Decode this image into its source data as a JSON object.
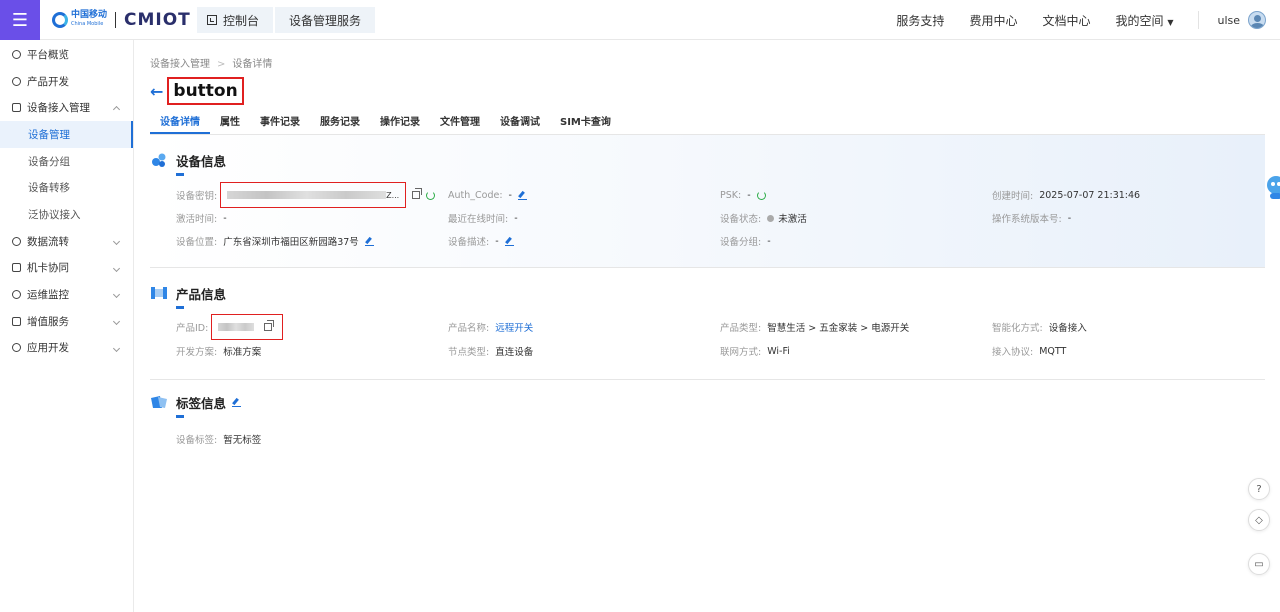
{
  "header": {
    "logo_cn": "中国移动",
    "logo_en": "China Mobile",
    "logo_brand": "CMIOT",
    "tabs": [
      "控制台",
      "设备管理服务"
    ],
    "nav": [
      "服务支持",
      "费用中心",
      "文档中心",
      "我的空间"
    ],
    "user": "ulse"
  },
  "sidebar": {
    "items": [
      {
        "label": "平台概览",
        "icon": "dashboard-icon"
      },
      {
        "label": "产品开发",
        "icon": "product-icon"
      },
      {
        "label": "设备接入管理",
        "icon": "device-icon"
      },
      {
        "label": "设备管理",
        "sub": true,
        "active": true
      },
      {
        "label": "设备分组",
        "sub": true
      },
      {
        "label": "设备转移",
        "sub": true
      },
      {
        "label": "泛协议接入",
        "sub": true
      },
      {
        "label": "数据流转",
        "icon": "dataflow-icon"
      },
      {
        "label": "机卡协同",
        "icon": "card-icon"
      },
      {
        "label": "运维监控",
        "icon": "monitor-icon"
      },
      {
        "label": "增值服务",
        "icon": "value-icon"
      },
      {
        "label": "应用开发",
        "icon": "app-icon"
      }
    ]
  },
  "breadcrumb": [
    "设备接入管理",
    "设备详情"
  ],
  "page": {
    "title": "button"
  },
  "tabs": [
    "设备详情",
    "属性",
    "事件记录",
    "服务记录",
    "操作记录",
    "文件管理",
    "设备调试",
    "SIM卡查询"
  ],
  "device_info": {
    "title": "设备信息",
    "key_label": "设备密钥:",
    "key_tail": "Z...",
    "auth_label": "Auth_Code:",
    "auth_value": "-",
    "psk_label": "PSK:",
    "psk_value": "-",
    "created_label": "创建时间:",
    "created_value": "2025-07-07 21:31:46",
    "activate_label": "激活时间:",
    "activate_value": "-",
    "online_label": "最近在线时间:",
    "online_value": "-",
    "status_label": "设备状态:",
    "status_value": "未激活",
    "os_label": "操作系统版本号:",
    "os_value": "-",
    "location_label": "设备位置:",
    "location_value": "广东省深圳市福田区新园路37号",
    "desc_label": "设备描述:",
    "desc_value": "-",
    "group_label": "设备分组:",
    "group_value": "-"
  },
  "product_info": {
    "title": "产品信息",
    "pid_label": "产品ID:",
    "name_label": "产品名称:",
    "name_value": "远程开关",
    "type_label": "产品类型:",
    "type_value": "智慧生活 > 五金家装 > 电源开关",
    "smart_label": "智能化方式:",
    "smart_value": "设备接入",
    "dev_label": "开发方案:",
    "dev_value": "标准方案",
    "node_label": "节点类型:",
    "node_value": "直连设备",
    "net_label": "联网方式:",
    "net_value": "Wi-Fi",
    "proto_label": "接入协议:",
    "proto_value": "MQTT"
  },
  "tag_info": {
    "title": "标签信息",
    "label": "设备标签:",
    "value": "暂无标签"
  },
  "colors": {
    "brand_purple": "#6a4fe8",
    "primary_blue": "#1f6fd6",
    "highlight_red": "#e02020",
    "success_green": "#2fae4a"
  }
}
